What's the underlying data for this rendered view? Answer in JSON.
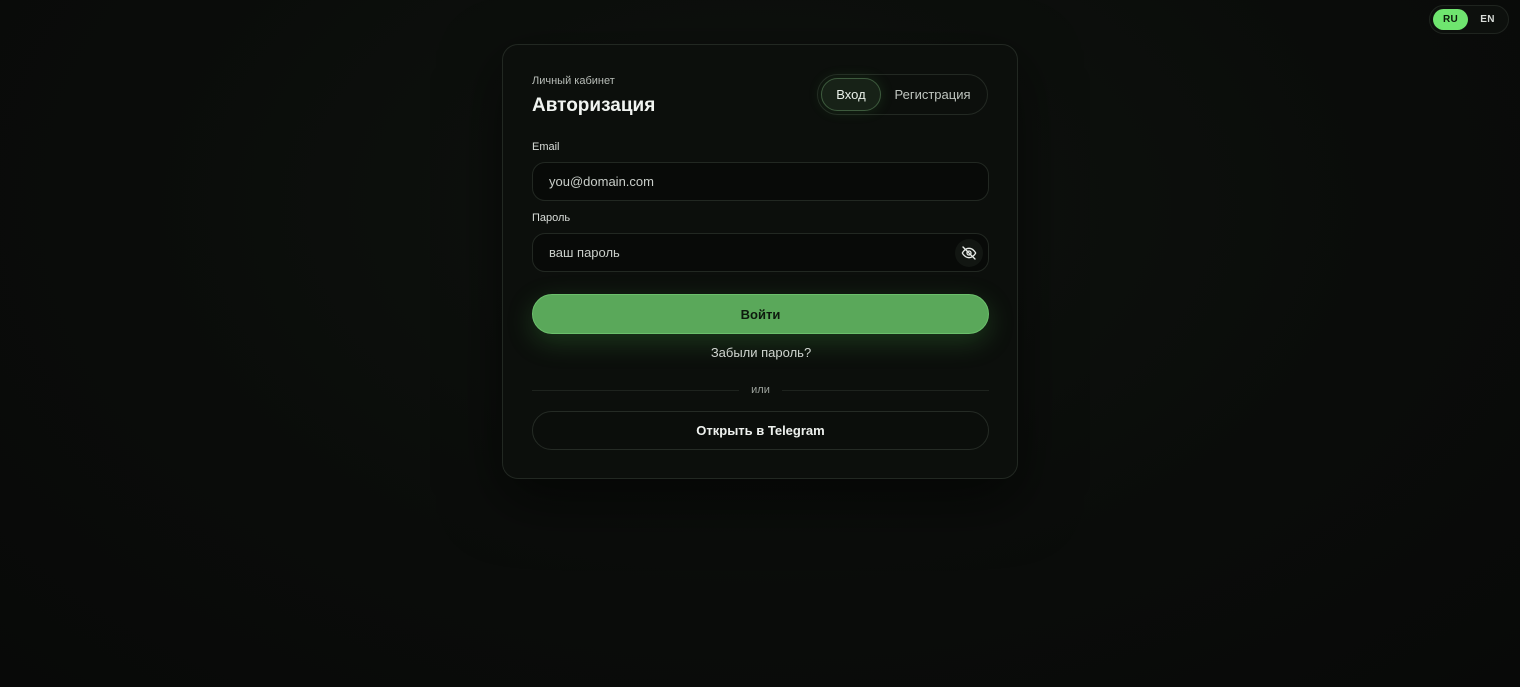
{
  "language_switch": {
    "options": [
      {
        "label": "RU",
        "active": true
      },
      {
        "label": "EN",
        "active": false
      }
    ]
  },
  "auth_card": {
    "subtitle": "Личный кабинет",
    "title": "Авторизация",
    "tabs": [
      {
        "label": "Вход",
        "active": true
      },
      {
        "label": "Регистрация",
        "active": false
      }
    ],
    "email": {
      "label": "Email",
      "value": "",
      "placeholder": "you@domain.com"
    },
    "password": {
      "label": "Пароль",
      "value": "",
      "placeholder": "ваш пароль",
      "toggle_icon": "eye-off-icon"
    },
    "submit_label": "Войти",
    "forgot_label": "Забыли пароль?",
    "divider_label": "или",
    "telegram_label": "Открыть в Telegram"
  },
  "colors": {
    "accent": "#6fe56f",
    "button": "#5aa85a",
    "background": "#0b0d0b"
  }
}
